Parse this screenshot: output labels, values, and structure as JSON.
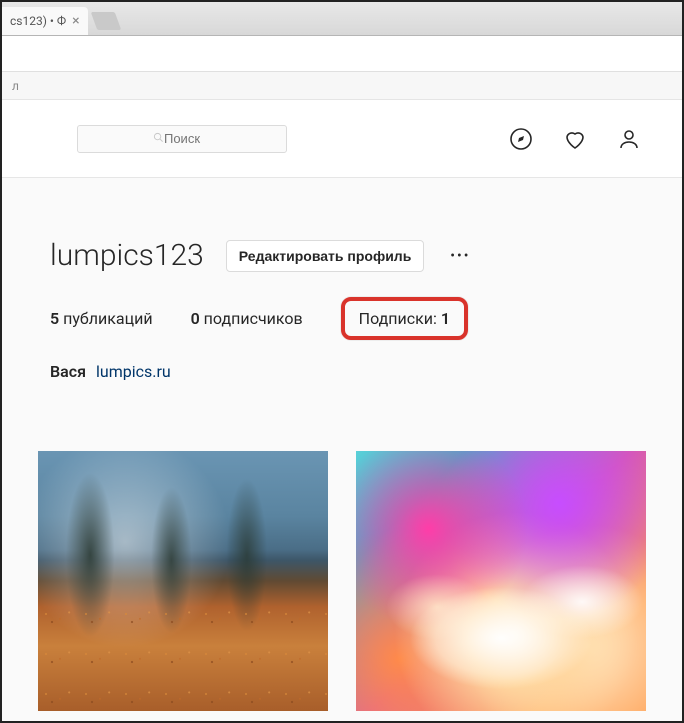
{
  "browser": {
    "tab_label": "cs123) • Ф",
    "bookmarks_hint": "л"
  },
  "header": {
    "search_placeholder": "Поиск"
  },
  "profile": {
    "username": "lumpics123",
    "edit_label": "Редактировать профиль",
    "stats": {
      "posts_count": "5",
      "posts_label": "публикаций",
      "followers_count": "0",
      "followers_label": "подписчиков",
      "following_label": "Подписки:",
      "following_count": "1"
    },
    "bio_name": "Вася",
    "bio_link": "lumpics.ru"
  }
}
